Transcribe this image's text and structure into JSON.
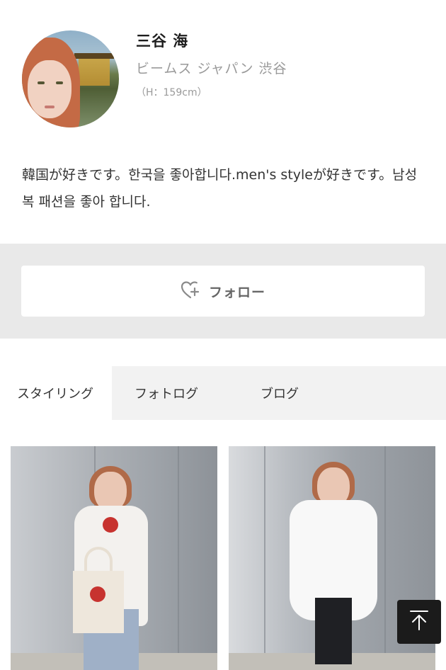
{
  "profile": {
    "name": "三谷 海",
    "shop": "ビームス ジャパン 渋谷",
    "height": "（H：159cm）",
    "bio": "韓国が好きです。한국을 좋아합니다.men's styleが好きです。남성복 패션을 좋아 합니다."
  },
  "follow": {
    "label": "フォロー",
    "icon": "heart-plus-icon"
  },
  "tabs": [
    {
      "label": "スタイリング",
      "active": true
    },
    {
      "label": "フォトログ",
      "active": false
    },
    {
      "label": "ブログ",
      "active": false
    }
  ],
  "scroll_top": {
    "icon": "arrow-up-to-top-icon"
  },
  "colors": {
    "band": "#e9e9e9",
    "tab_bg": "#f2f2f2",
    "scroll_button": "#1b1b1b"
  }
}
